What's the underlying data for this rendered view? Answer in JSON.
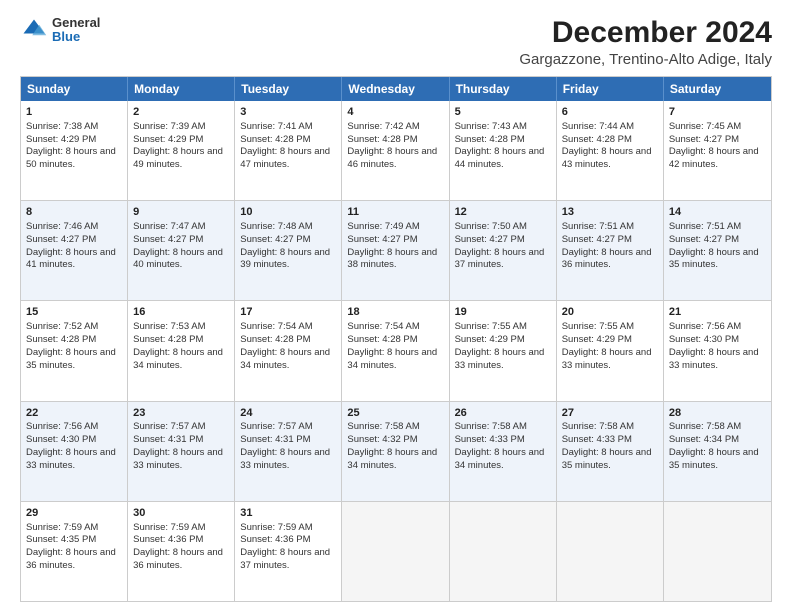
{
  "header": {
    "logo": {
      "general": "General",
      "blue": "Blue"
    },
    "title": "December 2024",
    "subtitle": "Gargazzone, Trentino-Alto Adige, Italy"
  },
  "days": [
    "Sunday",
    "Monday",
    "Tuesday",
    "Wednesday",
    "Thursday",
    "Friday",
    "Saturday"
  ],
  "weeks": [
    [
      {
        "day": "1",
        "sunrise": "7:38 AM",
        "sunset": "4:29 PM",
        "daylight": "8 hours and 50 minutes."
      },
      {
        "day": "2",
        "sunrise": "7:39 AM",
        "sunset": "4:29 PM",
        "daylight": "8 hours and 49 minutes."
      },
      {
        "day": "3",
        "sunrise": "7:41 AM",
        "sunset": "4:28 PM",
        "daylight": "8 hours and 47 minutes."
      },
      {
        "day": "4",
        "sunrise": "7:42 AM",
        "sunset": "4:28 PM",
        "daylight": "8 hours and 46 minutes."
      },
      {
        "day": "5",
        "sunrise": "7:43 AM",
        "sunset": "4:28 PM",
        "daylight": "8 hours and 44 minutes."
      },
      {
        "day": "6",
        "sunrise": "7:44 AM",
        "sunset": "4:28 PM",
        "daylight": "8 hours and 43 minutes."
      },
      {
        "day": "7",
        "sunrise": "7:45 AM",
        "sunset": "4:27 PM",
        "daylight": "8 hours and 42 minutes."
      }
    ],
    [
      {
        "day": "8",
        "sunrise": "7:46 AM",
        "sunset": "4:27 PM",
        "daylight": "8 hours and 41 minutes."
      },
      {
        "day": "9",
        "sunrise": "7:47 AM",
        "sunset": "4:27 PM",
        "daylight": "8 hours and 40 minutes."
      },
      {
        "day": "10",
        "sunrise": "7:48 AM",
        "sunset": "4:27 PM",
        "daylight": "8 hours and 39 minutes."
      },
      {
        "day": "11",
        "sunrise": "7:49 AM",
        "sunset": "4:27 PM",
        "daylight": "8 hours and 38 minutes."
      },
      {
        "day": "12",
        "sunrise": "7:50 AM",
        "sunset": "4:27 PM",
        "daylight": "8 hours and 37 minutes."
      },
      {
        "day": "13",
        "sunrise": "7:51 AM",
        "sunset": "4:27 PM",
        "daylight": "8 hours and 36 minutes."
      },
      {
        "day": "14",
        "sunrise": "7:51 AM",
        "sunset": "4:27 PM",
        "daylight": "8 hours and 35 minutes."
      }
    ],
    [
      {
        "day": "15",
        "sunrise": "7:52 AM",
        "sunset": "4:28 PM",
        "daylight": "8 hours and 35 minutes."
      },
      {
        "day": "16",
        "sunrise": "7:53 AM",
        "sunset": "4:28 PM",
        "daylight": "8 hours and 34 minutes."
      },
      {
        "day": "17",
        "sunrise": "7:54 AM",
        "sunset": "4:28 PM",
        "daylight": "8 hours and 34 minutes."
      },
      {
        "day": "18",
        "sunrise": "7:54 AM",
        "sunset": "4:28 PM",
        "daylight": "8 hours and 34 minutes."
      },
      {
        "day": "19",
        "sunrise": "7:55 AM",
        "sunset": "4:29 PM",
        "daylight": "8 hours and 33 minutes."
      },
      {
        "day": "20",
        "sunrise": "7:55 AM",
        "sunset": "4:29 PM",
        "daylight": "8 hours and 33 minutes."
      },
      {
        "day": "21",
        "sunrise": "7:56 AM",
        "sunset": "4:30 PM",
        "daylight": "8 hours and 33 minutes."
      }
    ],
    [
      {
        "day": "22",
        "sunrise": "7:56 AM",
        "sunset": "4:30 PM",
        "daylight": "8 hours and 33 minutes."
      },
      {
        "day": "23",
        "sunrise": "7:57 AM",
        "sunset": "4:31 PM",
        "daylight": "8 hours and 33 minutes."
      },
      {
        "day": "24",
        "sunrise": "7:57 AM",
        "sunset": "4:31 PM",
        "daylight": "8 hours and 33 minutes."
      },
      {
        "day": "25",
        "sunrise": "7:58 AM",
        "sunset": "4:32 PM",
        "daylight": "8 hours and 34 minutes."
      },
      {
        "day": "26",
        "sunrise": "7:58 AM",
        "sunset": "4:33 PM",
        "daylight": "8 hours and 34 minutes."
      },
      {
        "day": "27",
        "sunrise": "7:58 AM",
        "sunset": "4:33 PM",
        "daylight": "8 hours and 35 minutes."
      },
      {
        "day": "28",
        "sunrise": "7:58 AM",
        "sunset": "4:34 PM",
        "daylight": "8 hours and 35 minutes."
      }
    ],
    [
      {
        "day": "29",
        "sunrise": "7:59 AM",
        "sunset": "4:35 PM",
        "daylight": "8 hours and 36 minutes."
      },
      {
        "day": "30",
        "sunrise": "7:59 AM",
        "sunset": "4:36 PM",
        "daylight": "8 hours and 36 minutes."
      },
      {
        "day": "31",
        "sunrise": "7:59 AM",
        "sunset": "4:36 PM",
        "daylight": "8 hours and 37 minutes."
      },
      null,
      null,
      null,
      null
    ]
  ]
}
